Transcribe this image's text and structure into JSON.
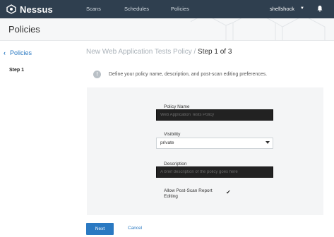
{
  "app": {
    "name": "Nessus"
  },
  "nav": {
    "items": [
      {
        "label": "Scans"
      },
      {
        "label": "Schedules"
      },
      {
        "label": "Policies"
      }
    ],
    "user": "shellshock"
  },
  "header": {
    "title": "Policies"
  },
  "sidebar": {
    "back_label": "Policies",
    "step_label": "Step 1"
  },
  "main": {
    "title_prefix": "New Web Application Tests Policy",
    "title_sep": " / ",
    "title_step": "Step 1 of 3",
    "info_icon": "!",
    "info_text": "Define your policy name, description, and post-scan editing preferences."
  },
  "form": {
    "policy_name": {
      "label": "Policy Name",
      "placeholder": "Web Application Tests Policy",
      "value": ""
    },
    "visibility": {
      "label": "Visibility",
      "value": "private"
    },
    "description": {
      "label": "Description",
      "placeholder": "A brief description of the policy goes here",
      "value": ""
    },
    "post_scan_editing": {
      "label": "Allow Post-Scan Report Editing",
      "checked": true
    }
  },
  "actions": {
    "next_label": "Next",
    "cancel_label": "Cancel"
  },
  "colors": {
    "topbar": "#2f3f4f",
    "accent": "#2a79c2",
    "panel": "#f4f5f6"
  }
}
